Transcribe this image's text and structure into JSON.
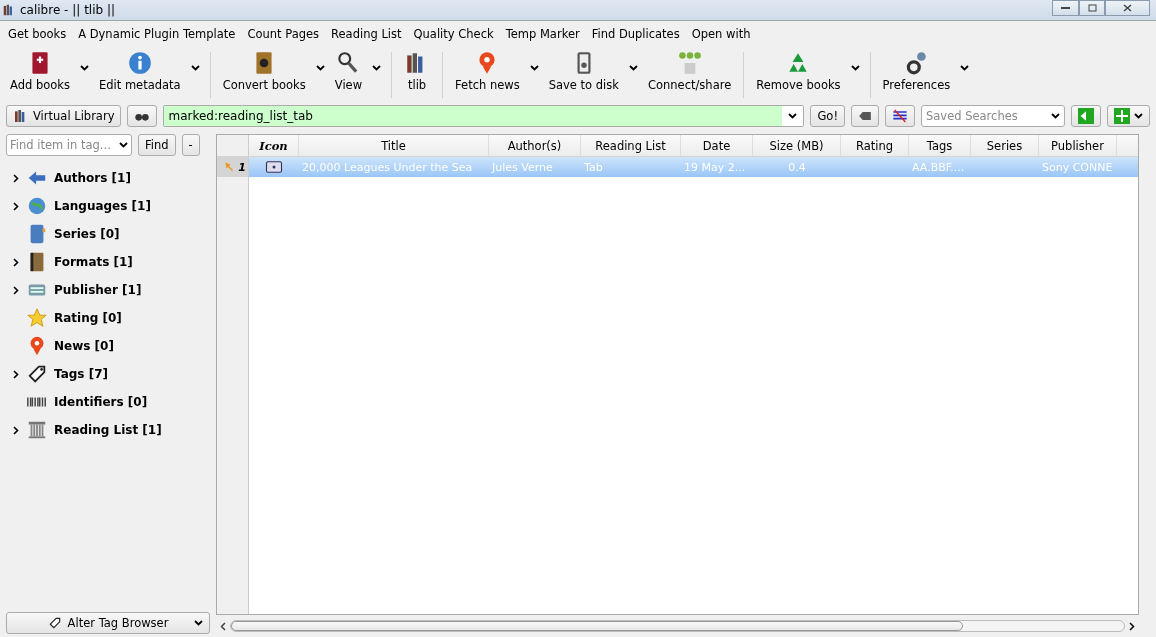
{
  "window": {
    "title": "calibre - || tlib ||"
  },
  "menu_bar": [
    "Get books",
    "A Dynamic Plugin Template",
    "Count Pages",
    "Reading List",
    "Quality Check",
    "Temp Marker",
    "Find Duplicates",
    "Open with"
  ],
  "toolbar": [
    {
      "label": "Add books",
      "menu": true,
      "separator_after": false
    },
    {
      "label": "Edit metadata",
      "menu": true,
      "separator_after": true
    },
    {
      "label": "Convert books",
      "menu": true,
      "separator_after": false
    },
    {
      "label": "View",
      "menu": true,
      "separator_after": true
    },
    {
      "label": "tlib",
      "menu": false,
      "separator_after": true
    },
    {
      "label": "Fetch news",
      "menu": true,
      "separator_after": false
    },
    {
      "label": "Save to disk",
      "menu": true,
      "separator_after": false
    },
    {
      "label": "Connect/share",
      "menu": false,
      "separator_after": true
    },
    {
      "label": "Remove books",
      "menu": true,
      "separator_after": true
    },
    {
      "label": "Preferences",
      "menu": true,
      "separator_after": false
    }
  ],
  "search_bar": {
    "virtual_library": "Virtual Library",
    "query": "marked:reading_list_tab",
    "go": "Go!",
    "saved_searches_placeholder": "Saved Searches"
  },
  "tag_browser": {
    "find_placeholder": "Find item in tag...",
    "find": "Find",
    "collapse": "-",
    "items": [
      {
        "label": "Authors [1]",
        "expandable": true
      },
      {
        "label": "Languages [1]",
        "expandable": true
      },
      {
        "label": "Series [0]",
        "expandable": false
      },
      {
        "label": "Formats [1]",
        "expandable": true
      },
      {
        "label": "Publisher [1]",
        "expandable": true
      },
      {
        "label": "Rating [0]",
        "expandable": false
      },
      {
        "label": "News [0]",
        "expandable": false
      },
      {
        "label": "Tags [7]",
        "expandable": true
      },
      {
        "label": "Identifiers [0]",
        "expandable": false
      },
      {
        "label": "Reading List [1]",
        "expandable": true
      }
    ],
    "alter": "Alter Tag Browser"
  },
  "table": {
    "columns": [
      "Icon",
      "Title",
      "Author(s)",
      "Reading List",
      "Date",
      "Size (MB)",
      "Rating",
      "Tags",
      "Series",
      "Publisher"
    ],
    "rows": [
      {
        "number": "1",
        "selected": true,
        "cells": [
          "",
          "20,000 Leagues Under the Sea",
          "Jules Verne",
          "Tab",
          "19 May 2...",
          "0.4",
          "",
          "AA.BBF....",
          "",
          "Sony CONNE"
        ]
      }
    ]
  }
}
